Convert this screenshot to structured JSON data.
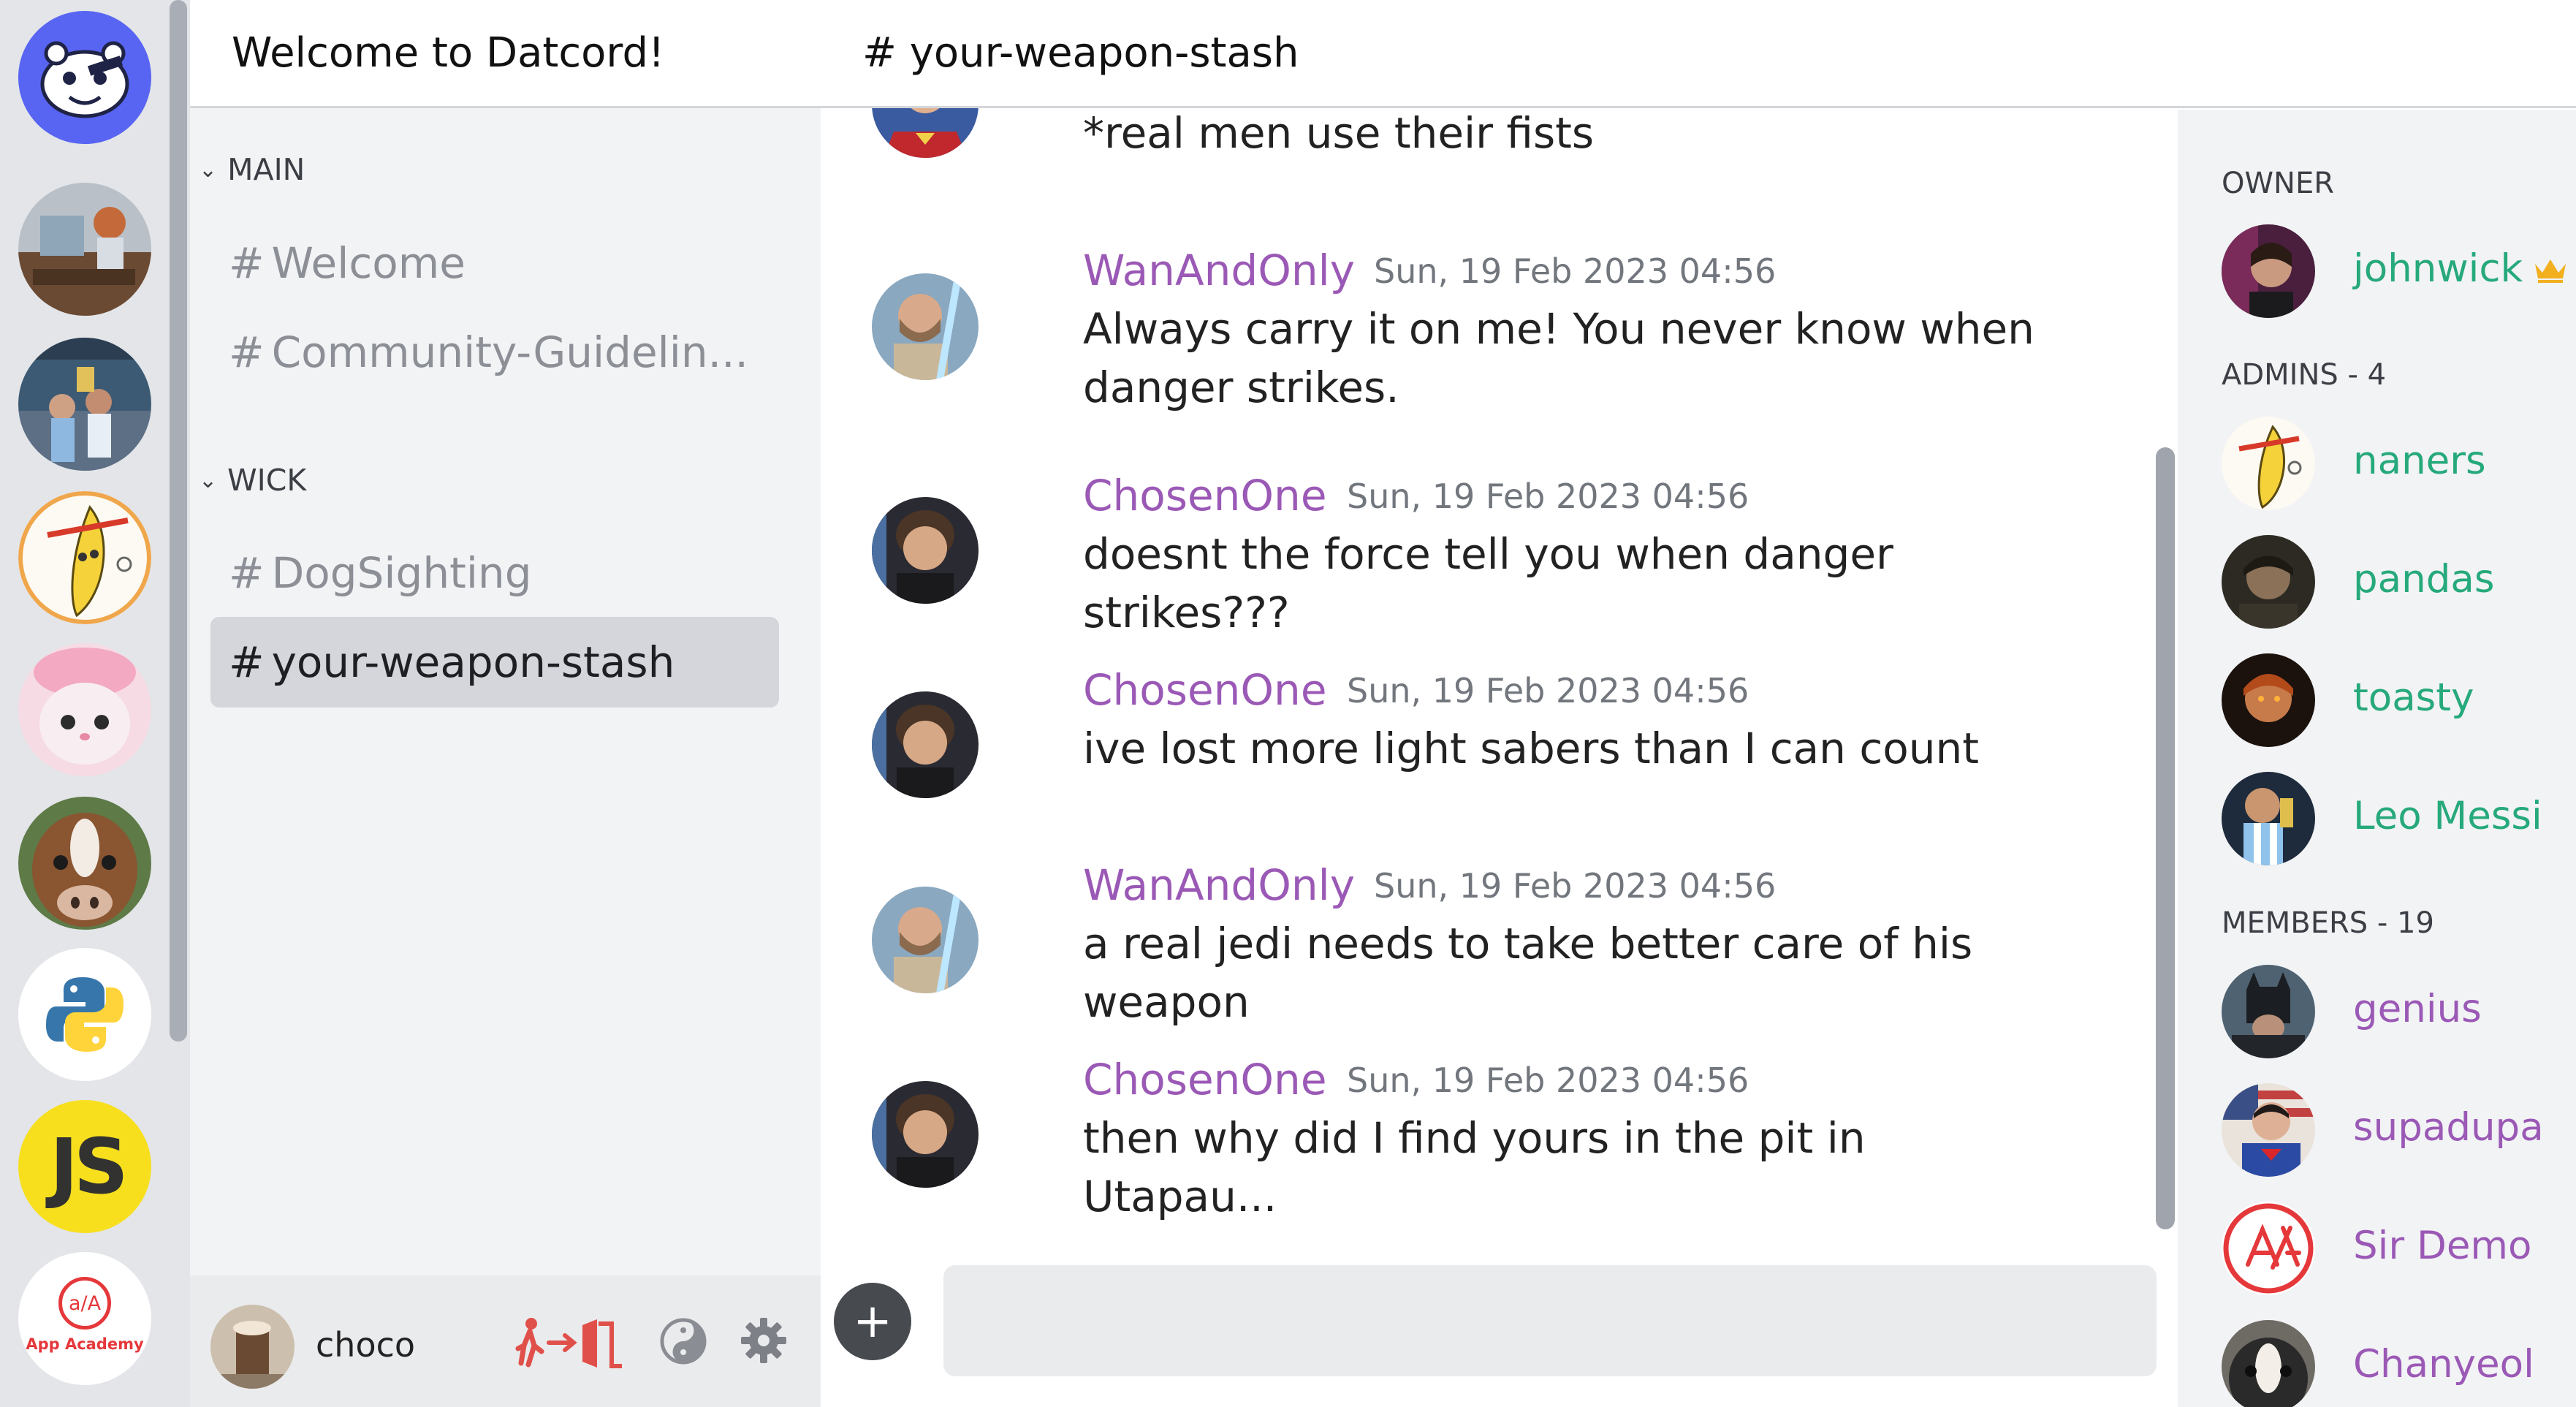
{
  "colors": {
    "accent_admin": "#26a97b",
    "accent_member": "#9b59b6",
    "author": "#9b59b6",
    "timestamp": "#72767d",
    "crown": "#f2b01e",
    "logout": "#e0504a"
  },
  "servers": [
    {
      "name": "discord-logo"
    },
    {
      "name": "office-server"
    },
    {
      "name": "football-server"
    },
    {
      "name": "banana-server"
    },
    {
      "name": "pink-cat-server"
    },
    {
      "name": "cow-server"
    },
    {
      "name": "python-server"
    },
    {
      "name": "javascript-server",
      "label": "JS"
    },
    {
      "name": "app-academy-server",
      "label": "App Academy",
      "mark": "a/A"
    }
  ],
  "sidebar": {
    "title": "Welcome to Datcord!",
    "categories": [
      {
        "label": "MAIN",
        "channels": [
          "Welcome",
          "Community-Guidelin..."
        ]
      },
      {
        "label": "WICK",
        "channels": [
          "DogSighting",
          "your-weapon-stash"
        ]
      }
    ],
    "hash": "#"
  },
  "user": {
    "name": "choco"
  },
  "chat": {
    "channel_title": "# your-weapon-stash",
    "partial_message": "*real men use their fists",
    "messages": [
      {
        "author": "WanAndOnly",
        "time": "Sun, 19 Feb 2023 04:56",
        "text": "Always carry it on me! You never know when danger strikes."
      },
      {
        "author": "ChosenOne",
        "time": "Sun, 19 Feb 2023 04:56",
        "text": "doesnt the force tell you when danger strikes???"
      },
      {
        "author": "ChosenOne",
        "time": "Sun, 19 Feb 2023 04:56",
        "text": "ive lost more light sabers than I can count"
      },
      {
        "author": "WanAndOnly",
        "time": "Sun, 19 Feb 2023 04:56",
        "text": "a real jedi needs to take better care of his weapon"
      },
      {
        "author": "ChosenOne",
        "time": "Sun, 19 Feb 2023 04:56",
        "text": "then why did I find yours in the pit in Utapau..."
      }
    ],
    "add_label": "+",
    "input_value": ""
  },
  "members": {
    "owner_title": "OWNER",
    "owner": {
      "name": "johnwick"
    },
    "admins_title": "ADMINS - 4",
    "admins": [
      {
        "name": "naners"
      },
      {
        "name": "pandas"
      },
      {
        "name": "toasty"
      },
      {
        "name": "Leo Messi"
      }
    ],
    "members_title": "MEMBERS - 19",
    "members": [
      {
        "name": "genius"
      },
      {
        "name": "supadupa"
      },
      {
        "name": "Sir Demo"
      },
      {
        "name": "Chanyeol"
      }
    ]
  }
}
